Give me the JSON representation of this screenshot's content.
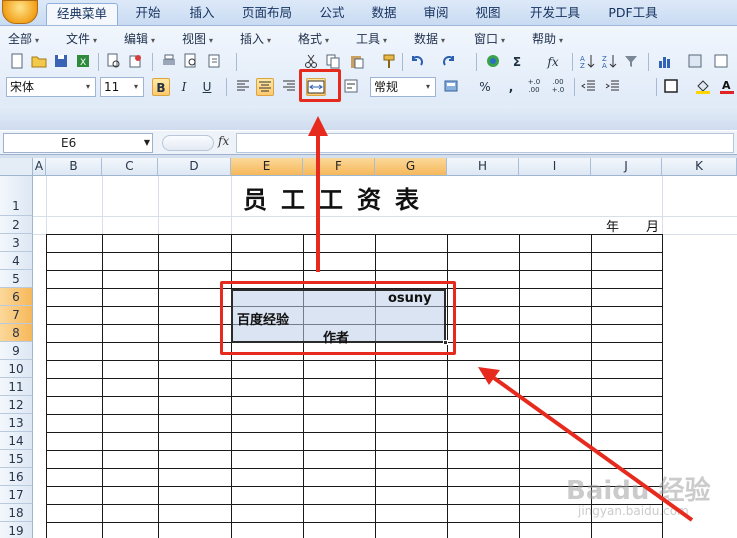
{
  "tabs": [
    "经典菜单",
    "开始",
    "插入",
    "页面布局",
    "公式",
    "数据",
    "审阅",
    "视图",
    "开发工具",
    "PDF工具"
  ],
  "menus": [
    "全部",
    "文件",
    "编辑",
    "视图",
    "插入",
    "格式",
    "工具",
    "数据",
    "窗口",
    "帮助"
  ],
  "toolbar": {
    "font_name": "宋体",
    "font_size": "11",
    "bold": "B",
    "italic": "I",
    "underline": "U",
    "number_format": "常规",
    "sum_glyph": "Σ",
    "fx_glyph": "fx",
    "percent": "%",
    "comma": ",",
    "inc_decimal": "+.0\n.00",
    "dec_decimal": ".00\n+.0"
  },
  "formula_bar": {
    "name_box": "E6",
    "fx_label": "fx",
    "content": ""
  },
  "columns": [
    "A",
    "B",
    "C",
    "D",
    "E",
    "F",
    "G",
    "H",
    "I",
    "J",
    "K"
  ],
  "selected_columns": [
    "E",
    "F",
    "G"
  ],
  "rows": [
    "1",
    "2",
    "3",
    "4",
    "5",
    "6",
    "7",
    "8",
    "9",
    "10",
    "11",
    "12",
    "13",
    "14",
    "15",
    "16",
    "17",
    "18",
    "19"
  ],
  "selected_rows": [
    "6",
    "7",
    "8"
  ],
  "sheet": {
    "title": "员工工资表",
    "year_label": "年",
    "month_label": "月",
    "cells": {
      "g6": "osuny",
      "e7": "百度经验",
      "f8": "作者"
    }
  },
  "annotation": {
    "color": "#e62b1e"
  },
  "watermark": {
    "brand": "Baidu 经验",
    "url": "jingyan.baidu.com"
  }
}
